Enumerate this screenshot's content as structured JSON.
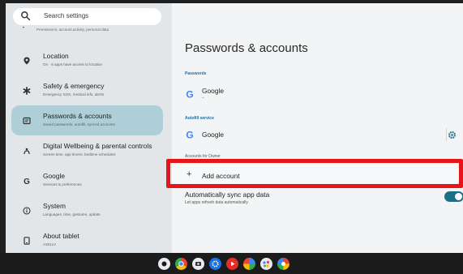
{
  "search": {
    "placeholder": "Search settings"
  },
  "sidebar": {
    "cut_item_subtitle": "Permissions, account activity, personal data",
    "items": [
      {
        "title": "Location",
        "subtitle": "On · 8 apps have access to location",
        "icon": "location-pin-icon"
      },
      {
        "title": "Safety & emergency",
        "subtitle": "Emergency SOS, medical info, alerts",
        "icon": "asterisk-icon"
      },
      {
        "title": "Passwords & accounts",
        "subtitle": "Saved passwords, autofill, synced accounts",
        "icon": "key-card-icon",
        "active": true
      },
      {
        "title": "Digital Wellbeing & parental controls",
        "subtitle": "Screen time, app timers, bedtime schedules",
        "icon": "wellbeing-icon"
      },
      {
        "title": "Google",
        "subtitle": "Services & preferences",
        "icon": "google-g-icon"
      },
      {
        "title": "System",
        "subtitle": "Languages, time, gestures, update",
        "icon": "info-icon"
      },
      {
        "title": "About tablet",
        "subtitle": "A301LV",
        "icon": "tablet-icon"
      }
    ]
  },
  "main": {
    "title": "Passwords & accounts",
    "passwords_header": "Passwords",
    "passwords_provider": "Google",
    "passwords_sub": "–",
    "autofill_header": "Autofill service",
    "autofill_provider": "Google",
    "accounts_header_partial": "Accounts for Owner",
    "add_account": "Add account",
    "sync_title": "Automatically sync app data",
    "sync_sub": "Let apps refresh data automatically",
    "sync_enabled": true
  },
  "colors": {
    "active_bg": "#aecfd8",
    "accent": "#1e6f86",
    "highlight": "#e8141a"
  },
  "taskbar": {
    "apps": [
      "launcher-icon",
      "chrome-icon",
      "camera-icon",
      "settings-icon",
      "youtube-music-icon",
      "photos-icon",
      "assistant-icon",
      "play-games-icon"
    ]
  }
}
